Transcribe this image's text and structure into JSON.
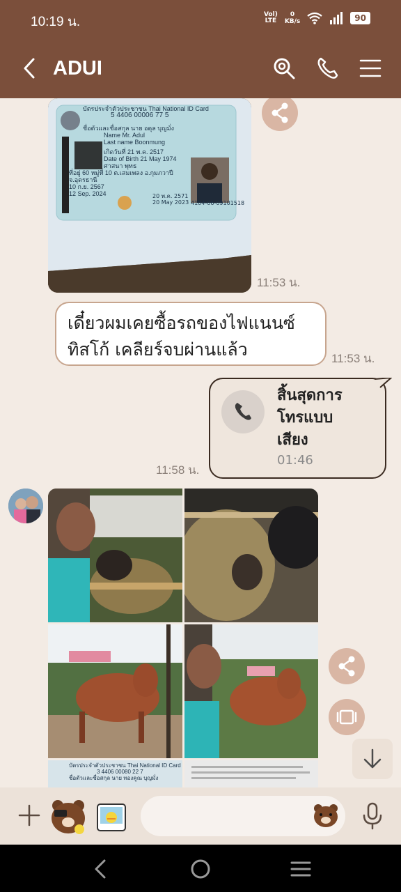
{
  "status_bar": {
    "time": "10:19 น.",
    "network_top": "Vol)",
    "network_bottom": "LTE",
    "speed_top": "0",
    "speed_bottom": "KB/s",
    "battery": "90"
  },
  "header": {
    "title": "ADUI",
    "icons": [
      "back-icon",
      "search-icon",
      "phone-icon",
      "menu-icon"
    ]
  },
  "messages": [
    {
      "type": "image",
      "description_key": "id-card-photo",
      "time": "11:53 น."
    },
    {
      "type": "text",
      "line1": "เดี๋ยวผมเคยซื้อรถของไฟแนนซ์",
      "line2": "ทิสโก้ เคลียร์จบผ่านแล้ว",
      "time": "11:53 น."
    },
    {
      "type": "call",
      "text": "สิ้นสุดการโทรแบบเสียง",
      "line1": "สิ้นสุดการ",
      "line2": "โทรแบบ",
      "line3": "เสียง",
      "duration": "01:46",
      "time": "11:58 น."
    }
  ],
  "id_card": {
    "header": "บัตรประจำตัวประชาชน Thai National ID Card",
    "number": "5 4406 00006 77 5",
    "name_th": "ชื่อตัวและชื่อสกุล นาย อดุล บุญมั่ง",
    "name_en": "Name Mr. Adul",
    "last_name": "Last name Boonmung",
    "dob_th": "เกิดวันที่ 21 พ.ค. 2517",
    "dob_en": "Date of Birth 21 May 1974",
    "religion": "ศาสนา พุทธ",
    "address": "ที่อยู่ 60 หมู่ที่ 10 ต.เสมเพลง อ.กุมภวาปี",
    "province": "จ.อุดรธานี",
    "issue_th": "10 ก.ย. 2567",
    "issue_en": "12 Sep. 2024",
    "expiry_th": "20 พ.ค. 2571",
    "expiry_en": "20 May 2023",
    "serial": "4104-06-09101518",
    "second_card_number": "3 4406 00080 22 7",
    "second_card_name": "ชื่อตัวและชื่อสกุล นาย ทองคูณ บุญมั่ง"
  },
  "colors": {
    "header_bg": "#7b4f3b",
    "chat_bg": "#f3ebe4",
    "bubble_border": "#c7a58e",
    "share_button": "#d9b6a4"
  },
  "input": {
    "placeholder": ""
  }
}
